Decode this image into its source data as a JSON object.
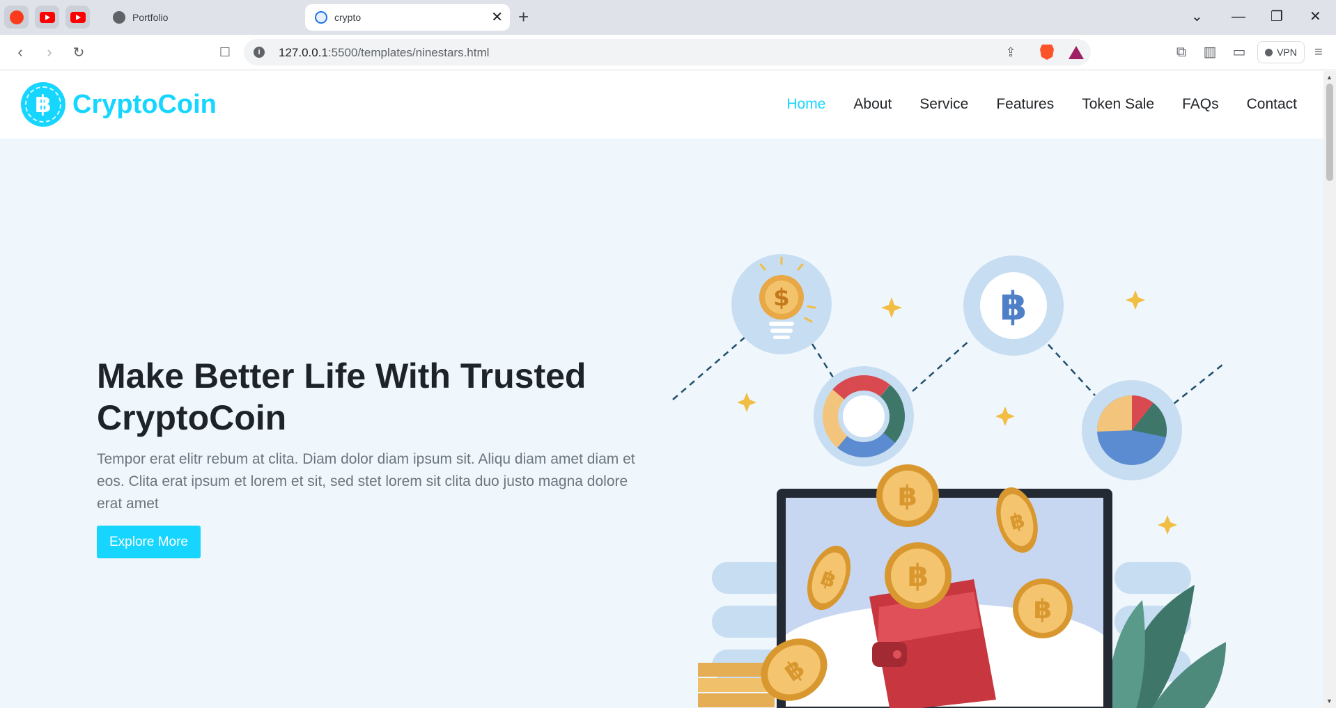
{
  "browser": {
    "tabs": [
      {
        "title": "Portfolio"
      },
      {
        "title": "crypto"
      }
    ],
    "url_host": "127.0.0.1",
    "url_path": ":5500/templates/ninestars.html",
    "vpn_label": "VPN"
  },
  "site": {
    "brand": "CryptoCoin",
    "logo_glyph": "฿",
    "nav": [
      "Home",
      "About",
      "Service",
      "Features",
      "Token Sale",
      "FAQs",
      "Contact"
    ],
    "active_nav": "Home",
    "hero": {
      "title": "Make Better Life With Trusted CryptoCoin",
      "description": "Tempor erat elitr rebum at clita. Diam dolor diam ipsum sit. Aliqu diam amet diam et eos. Clita erat ipsum et lorem et sit, sed stet lorem sit clita duo justo magna dolore erat amet",
      "cta": "Explore More"
    }
  },
  "colors": {
    "accent": "#16d5ff",
    "hero_bg": "#eff6fc",
    "heading": "#1e2329",
    "text_muted": "#6c757d"
  },
  "icons": [
    "back-icon",
    "forward-icon",
    "reload-icon",
    "bookmark-icon",
    "info-icon",
    "share-icon",
    "brave-shields-icon",
    "bat-rewards-icon",
    "extensions-icon",
    "sidebar-icon",
    "wallet-icon",
    "menu-icon"
  ]
}
